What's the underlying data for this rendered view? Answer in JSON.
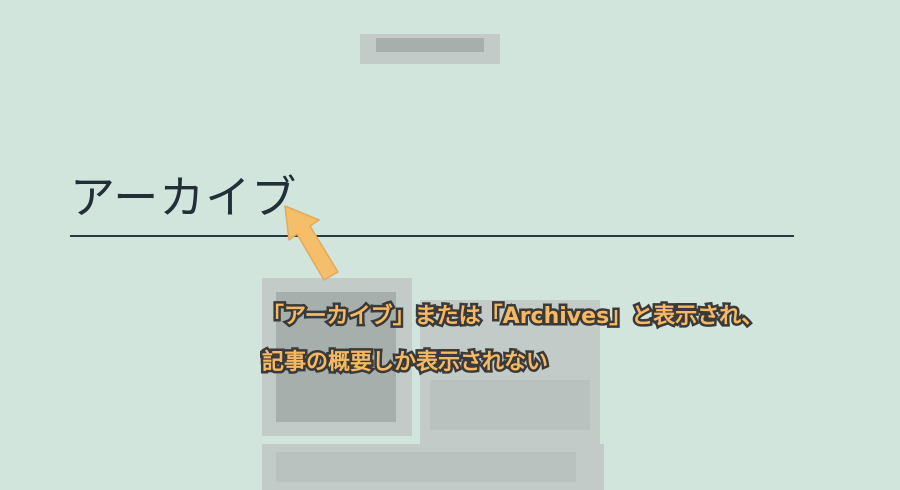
{
  "colors": {
    "background": "#d1e5dd",
    "title_text": "#222f36",
    "rule": "#2b3a40",
    "annotation_fill": "#f4b962",
    "annotation_outline": "#3b3b3b",
    "arrow": "#f5be68"
  },
  "page": {
    "title": "アーカイブ"
  },
  "annotation": {
    "line1": "「アーカイブ」または「Archives」と表示され、",
    "line2": "記事の概要しか表示されない"
  },
  "icons": {
    "pointer": "arrow-up-left-icon"
  }
}
